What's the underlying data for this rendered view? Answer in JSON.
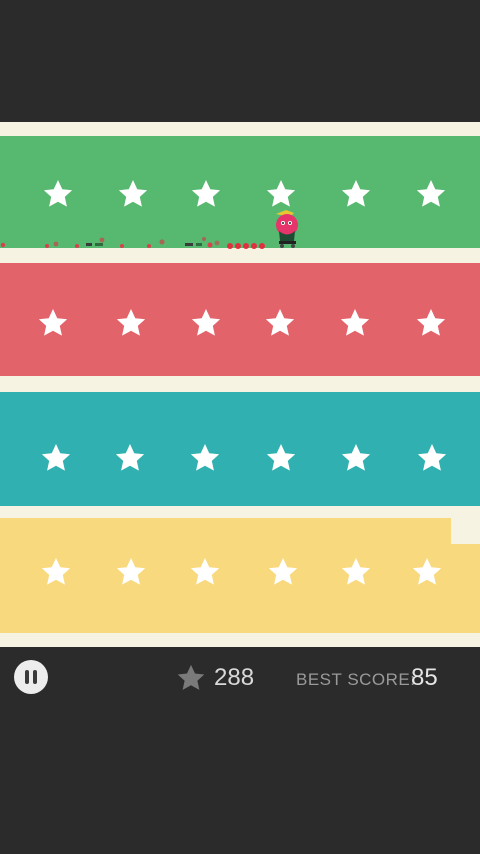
{
  "lanes": [
    {
      "id": "green",
      "color": "#57b86f",
      "stars": 6
    },
    {
      "id": "red",
      "color": "#e3636b",
      "stars": 6
    },
    {
      "id": "teal",
      "color": "#30b0b0",
      "stars": 6
    },
    {
      "id": "yellow",
      "color": "#f8d97d",
      "stars": 6
    }
  ],
  "hud": {
    "pause_icon": "pause-icon",
    "star_icon": "star-icon",
    "stars_collected": "288",
    "best_score_label": "BEST SCORE:",
    "best_score_value": "85"
  },
  "player": {
    "icon": "runner-character"
  }
}
